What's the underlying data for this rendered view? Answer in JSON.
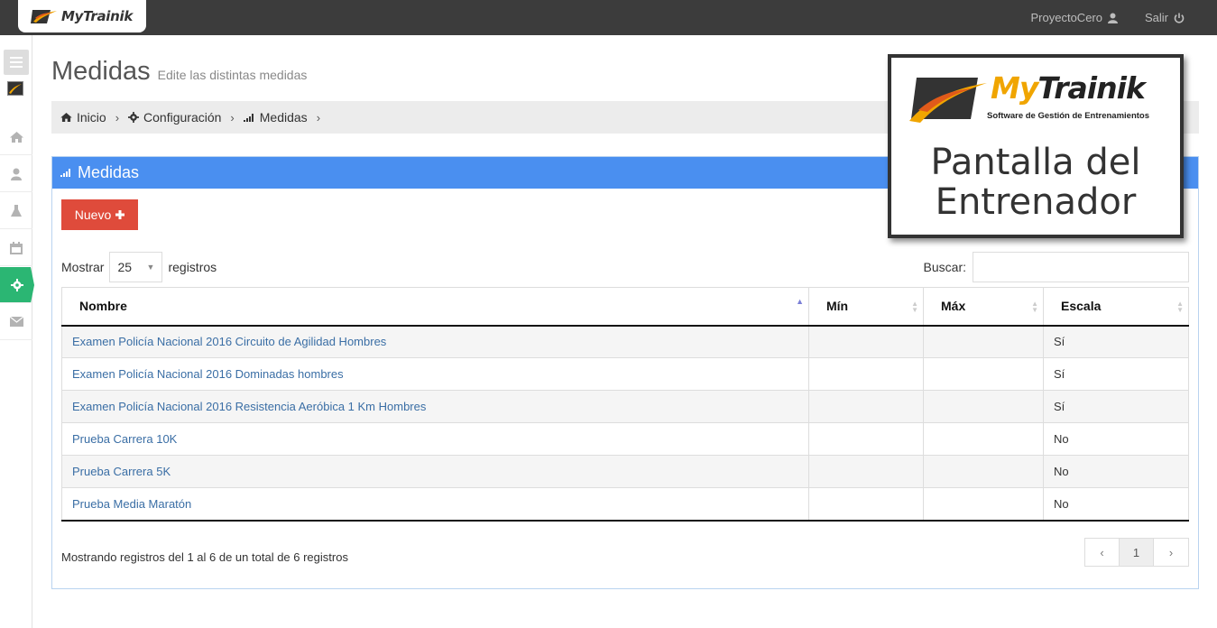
{
  "header": {
    "logo_text": "MyTrainik",
    "user_label": "ProyectoCero",
    "logout_label": "Salir"
  },
  "page": {
    "title": "Medidas",
    "subtitle": "Edite las distintas medidas"
  },
  "breadcrumb": {
    "items": [
      "Inicio",
      "Configuración",
      "Medidas"
    ]
  },
  "panel": {
    "title": "Medidas",
    "new_button": "Nuevo",
    "show_label": "Mostrar",
    "show_value": "25",
    "records_label": "registros",
    "search_label": "Buscar:"
  },
  "table": {
    "columns": [
      "Nombre",
      "Mín",
      "Máx",
      "Escala"
    ],
    "rows": [
      {
        "nombre": "Examen Policía Nacional 2016 Circuito de Agilidad Hombres",
        "min": "",
        "max": "",
        "escala": "Sí"
      },
      {
        "nombre": "Examen Policía Nacional 2016 Dominadas hombres",
        "min": "",
        "max": "",
        "escala": "Sí"
      },
      {
        "nombre": "Examen Policía Nacional 2016 Resistencia Aeróbica 1 Km Hombres",
        "min": "",
        "max": "",
        "escala": "Sí"
      },
      {
        "nombre": "Prueba Carrera 10K",
        "min": "",
        "max": "",
        "escala": "No"
      },
      {
        "nombre": "Prueba Carrera 5K",
        "min": "",
        "max": "",
        "escala": "No"
      },
      {
        "nombre": "Prueba Media Maratón",
        "min": "",
        "max": "",
        "escala": "No"
      }
    ]
  },
  "footer": {
    "info": "Mostrando registros del 1 al 6 de un total de 6 registros",
    "page_prev": "‹",
    "page_current": "1",
    "page_next": "›"
  },
  "overlay": {
    "brand_my": "My",
    "brand_trainik": "Trainik",
    "tagline": "Software de Gestión de Entrenamientos",
    "title_line1": "Pantalla del",
    "title_line2": "Entrenador"
  },
  "colors": {
    "topbar": "#3c3c3c",
    "panel_header": "#4a8ff0",
    "new_button": "#df4b3b",
    "sidebar_active": "#2bb673",
    "brand_accent": "#f0a500"
  }
}
